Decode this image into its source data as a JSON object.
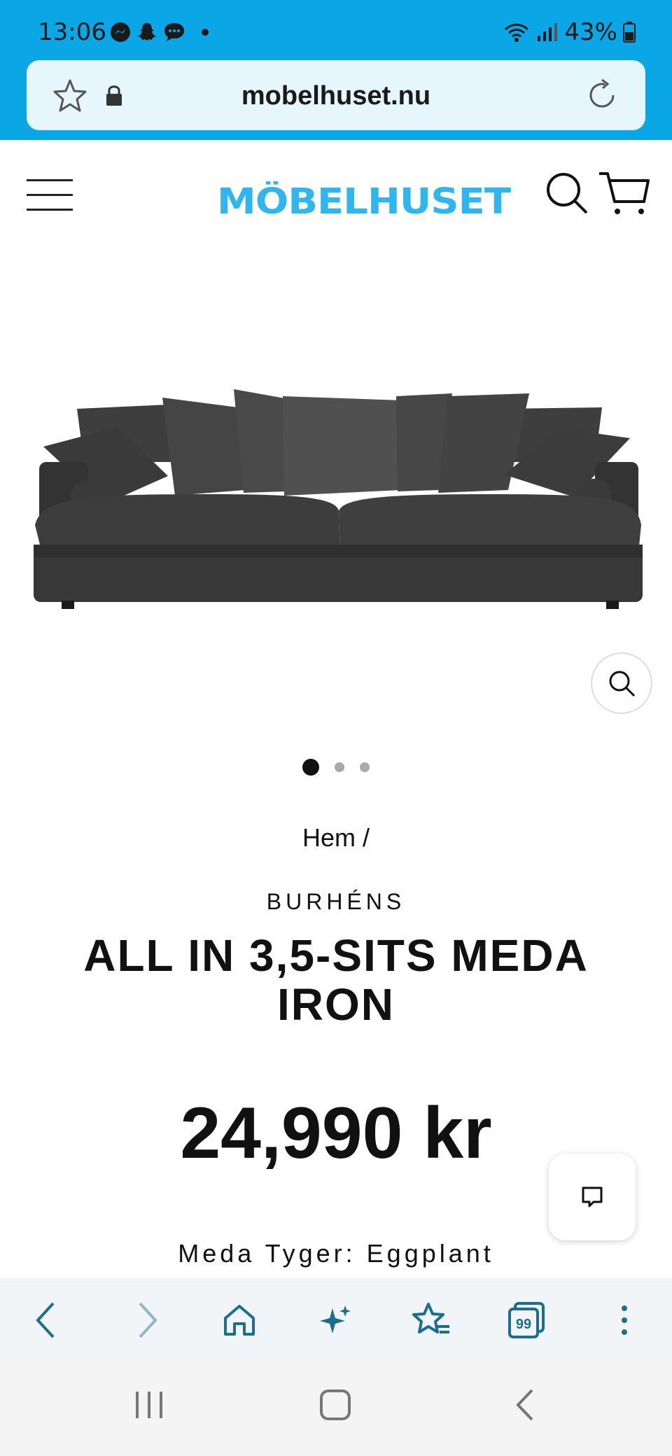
{
  "status_bar": {
    "time": "13:06",
    "battery": "43%"
  },
  "url_bar": {
    "url": "mobelhuset.nu"
  },
  "site": {
    "logo_text": "MÖBELHUSET",
    "brand_color": "#2fb6ee"
  },
  "product": {
    "image_alt": "sofa-image",
    "carousel_dots": 3,
    "breadcrumb": "Hem /",
    "vendor": "BURHÉNS",
    "title": "ALL IN 3,5-SITS MEDA IRON",
    "price": "24,990 kr",
    "option": "Meda Tyger: Eggplant"
  },
  "colors": {
    "chrome_blue": "#0aa6e6",
    "url_bar_bg": "#e6f6fd",
    "toolbar_icon": "#1a6f8e"
  },
  "icons": {
    "url_star": "star-icon",
    "url_lock": "lock-icon",
    "url_reload": "reload-icon",
    "menu": "hamburger-icon",
    "search": "search-icon",
    "cart": "cart-icon",
    "zoom": "zoom-icon",
    "chat": "chat-icon",
    "toolbar": [
      "back-icon",
      "forward-icon",
      "home-icon",
      "sparkle-icon",
      "bookmarks-icon",
      "tabs-icon",
      "more-icon"
    ],
    "nav": [
      "recents-icon",
      "home-nav-icon",
      "back-nav-icon"
    ]
  },
  "toolbar": {
    "tabs_count": "99"
  }
}
